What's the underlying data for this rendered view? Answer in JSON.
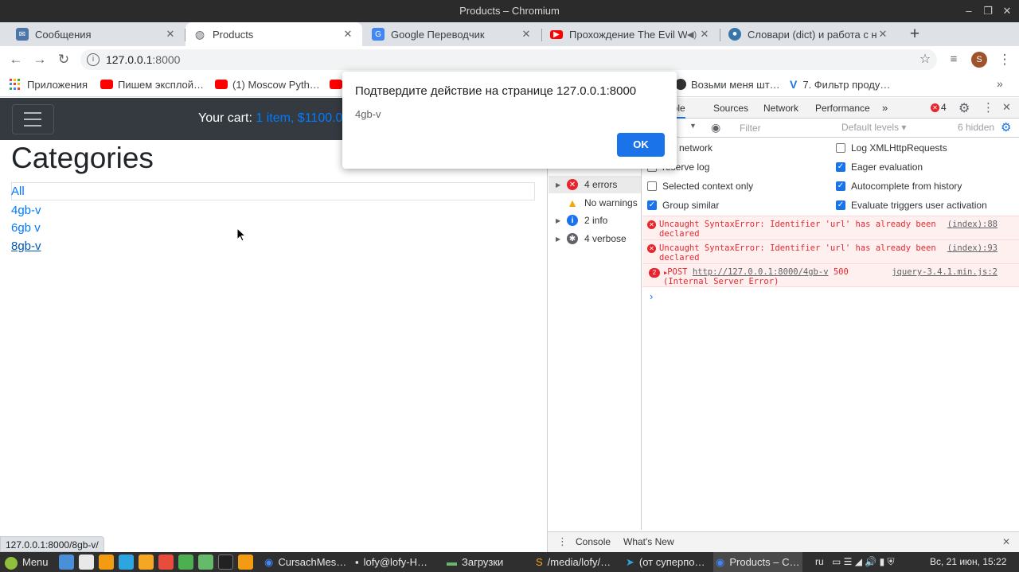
{
  "window": {
    "title": "Products – Chromium"
  },
  "tabs": [
    {
      "label": "Сообщения",
      "favicon": "vk-messages-icon",
      "color": "#4a76a8"
    },
    {
      "label": "Products",
      "favicon": "globe-icon",
      "color": "#5f6368"
    },
    {
      "label": "Google Переводчик",
      "favicon": "google-translate-icon",
      "color": "#4285f4"
    },
    {
      "label": "Прохождение The Evil W",
      "favicon": "youtube-icon",
      "color": "#ff0000"
    },
    {
      "label": "Словари (dict) и работа с ни",
      "favicon": "python-icon",
      "color": "#3776ab"
    }
  ],
  "omnibox": {
    "url_host": "127.0.0.1",
    "url_port": ":8000"
  },
  "bookmarks": [
    {
      "label": "Приложения",
      "color": "#ea4335"
    },
    {
      "label": "Пишем эксплой…",
      "color": "#ff0000"
    },
    {
      "label": "(1) Moscow Pyth…",
      "color": "#ff0000"
    },
    {
      "label": "Возьми меня шт…",
      "color": "#333333"
    },
    {
      "label": "7. Фильтр проду…",
      "color": "#1a73e8"
    }
  ],
  "page": {
    "cart_prefix": "Your cart:",
    "cart_link": "1 item, $1100.00",
    "heading": "Categories",
    "categories": [
      "All",
      "4gb-v",
      "6gb v",
      "8gb-v"
    ]
  },
  "dialog": {
    "title": "Подтвердите действие на странице 127.0.0.1:8000",
    "message": "4gb-v",
    "ok_label": "OK"
  },
  "devtools": {
    "tabs": [
      "nsole",
      "Sources",
      "Network",
      "Performance"
    ],
    "error_count": "4",
    "filter_placeholder": "Filter",
    "levels": "Default levels",
    "hidden": "6 hidden",
    "sidebar": [
      {
        "label": "4 errors",
        "icon": "error-icon",
        "color": "#e8252d"
      },
      {
        "label": "No warnings",
        "icon": "warning-icon",
        "color": "#f2a60c"
      },
      {
        "label": "2 info",
        "icon": "info-icon",
        "color": "#1a73e8"
      },
      {
        "label": "4 verbose",
        "icon": "bug-icon",
        "color": "#5f6368"
      }
    ],
    "options_left": [
      {
        "label": "e network",
        "checked": false
      },
      {
        "label": "reserve log",
        "checked": false
      },
      {
        "label": "Selected context only",
        "checked": false
      },
      {
        "label": "Group similar",
        "checked": true
      }
    ],
    "options_right": [
      {
        "label": "Log XMLHttpRequests",
        "checked": false
      },
      {
        "label": "Eager evaluation",
        "checked": true
      },
      {
        "label": "Autocomplete from history",
        "checked": true
      },
      {
        "label": "Evaluate triggers user activation",
        "checked": true
      }
    ],
    "messages": [
      {
        "text1": "Uncaught SyntaxError: Identifier 'url' has already been",
        "text2": "declared",
        "source": "(index):88"
      },
      {
        "text1": "Uncaught SyntaxError: Identifier 'url' has already been",
        "text2": "declared",
        "source": "(index):93"
      }
    ],
    "network_error": {
      "count": "2",
      "method": "POST",
      "url": "http://127.0.0.1:8000/4gb-v",
      "status": "500",
      "status_text": "(Internal Server Error)",
      "source": "jquery-3.4.1.min.js:2"
    },
    "drawer_tabs": [
      "Console",
      "What's New"
    ]
  },
  "status_bar": "127.0.0.1:8000/8gb-v/",
  "taskbar": {
    "menu": "Menu",
    "items": [
      "CursachMes…",
      "lofy@lofy-H…",
      "Загрузки",
      "/media/lofy/…",
      "(от суперпо…",
      "Products – C…"
    ],
    "lang": "ru",
    "clock": "Вс, 21 июн, 15:22"
  }
}
